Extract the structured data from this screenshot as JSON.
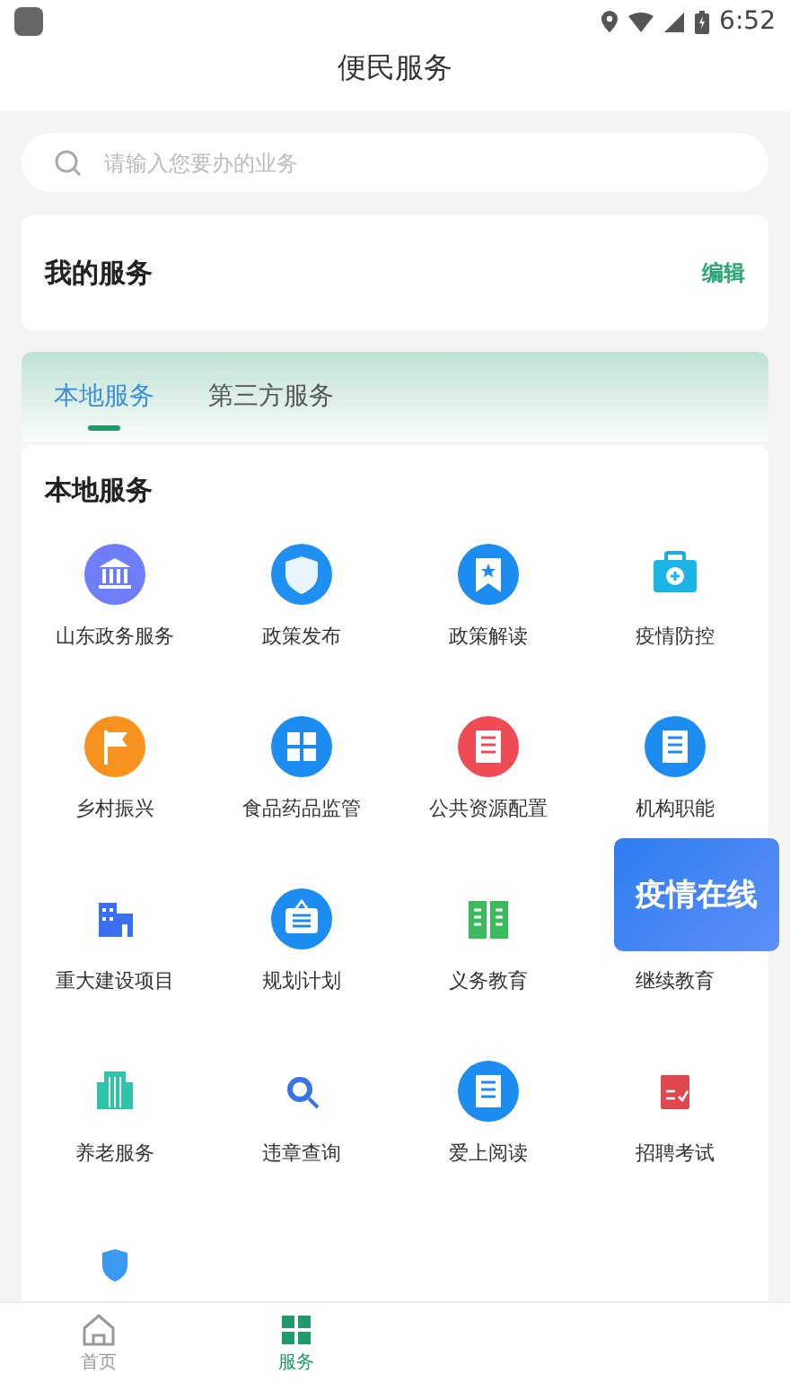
{
  "status_bar": {
    "time": "6:52"
  },
  "header": {
    "title": "便民服务"
  },
  "search": {
    "placeholder": "请输入您要办的业务"
  },
  "my_services": {
    "title": "我的服务",
    "action": "编辑"
  },
  "tabs": [
    {
      "label": "本地服务",
      "selected": true
    },
    {
      "label": "第三方服务",
      "selected": false
    }
  ],
  "local_services": {
    "title": "本地服务",
    "items": [
      {
        "kind": "service",
        "label": "山东政务服务"
      },
      {
        "kind": "service",
        "label": "政策发布"
      },
      {
        "kind": "service",
        "label": "政策解读"
      },
      {
        "kind": "service",
        "label": "疫情防控"
      },
      {
        "kind": "service",
        "label": "乡村振兴"
      },
      {
        "kind": "service",
        "label": "食品药品监管"
      },
      {
        "kind": "service",
        "label": "公共资源配置"
      },
      {
        "kind": "service",
        "label": "机构职能"
      },
      {
        "kind": "service",
        "label": "重大建设项目"
      },
      {
        "kind": "service",
        "label": "规划计划"
      },
      {
        "kind": "service",
        "label": "义务教育"
      },
      {
        "kind": "service",
        "label": "继续教育"
      },
      {
        "kind": "service",
        "label": "养老服务"
      },
      {
        "kind": "service",
        "label": "违章查询"
      },
      {
        "kind": "service",
        "label": "爱上阅读"
      },
      {
        "kind": "service",
        "label": "招聘考试"
      },
      {
        "kind": "icon_only"
      }
    ]
  },
  "banner": {
    "title": "疫情在线"
  },
  "bottom_nav": [
    {
      "label": "首页",
      "selected": false
    },
    {
      "label": "服务",
      "selected": true
    }
  ]
}
